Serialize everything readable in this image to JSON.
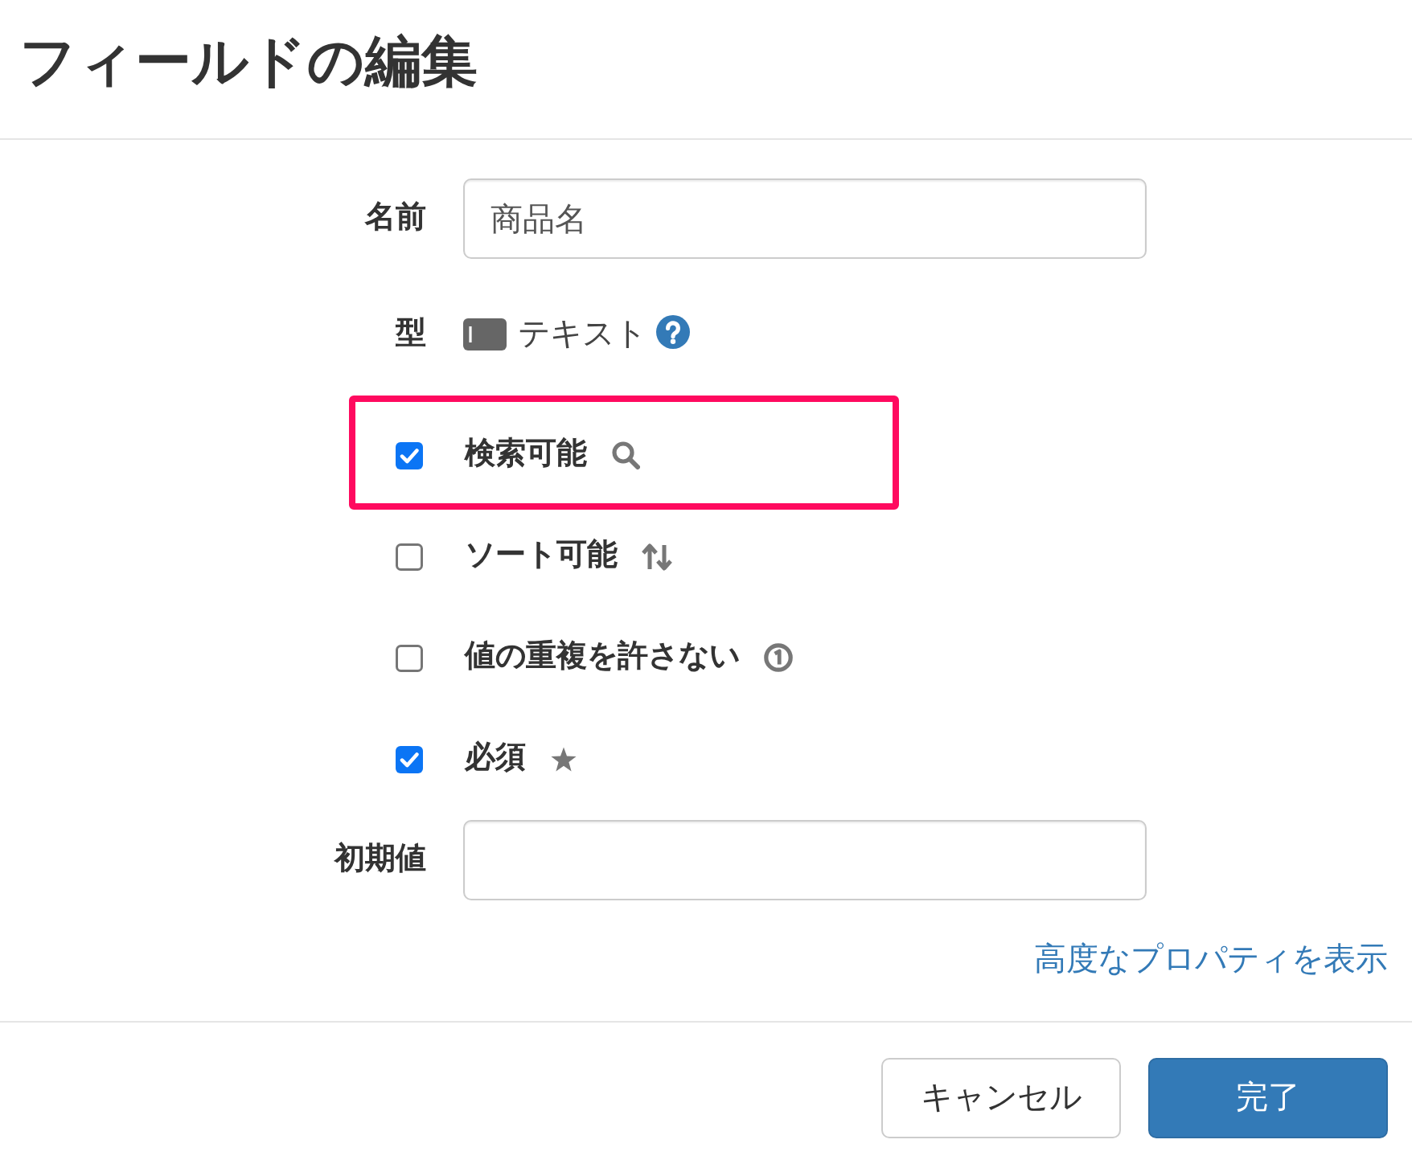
{
  "dialog": {
    "title": "フィールドの編集"
  },
  "fields": [
    {
      "kind": "text_input",
      "label": "名前",
      "value": "商品名"
    },
    {
      "kind": "type",
      "label": "型",
      "value": "テキスト"
    },
    {
      "kind": "checkbox",
      "label": "検索可能",
      "checked": true,
      "highlighted": true
    },
    {
      "kind": "checkbox",
      "label": "ソート可能",
      "checked": false,
      "highlighted": false
    },
    {
      "kind": "checkbox",
      "label": "値の重複を許さない",
      "checked": false,
      "highlighted": false
    },
    {
      "kind": "checkbox",
      "label": "必須",
      "checked": true,
      "highlighted": false
    },
    {
      "kind": "text_input",
      "label": "初期値"
    }
  ],
  "advanced_link": "高度なプロパティを表示",
  "buttons": [
    {
      "kind": "secondary",
      "label": "キャンセル"
    },
    {
      "kind": "primary",
      "label": "完了"
    }
  ]
}
